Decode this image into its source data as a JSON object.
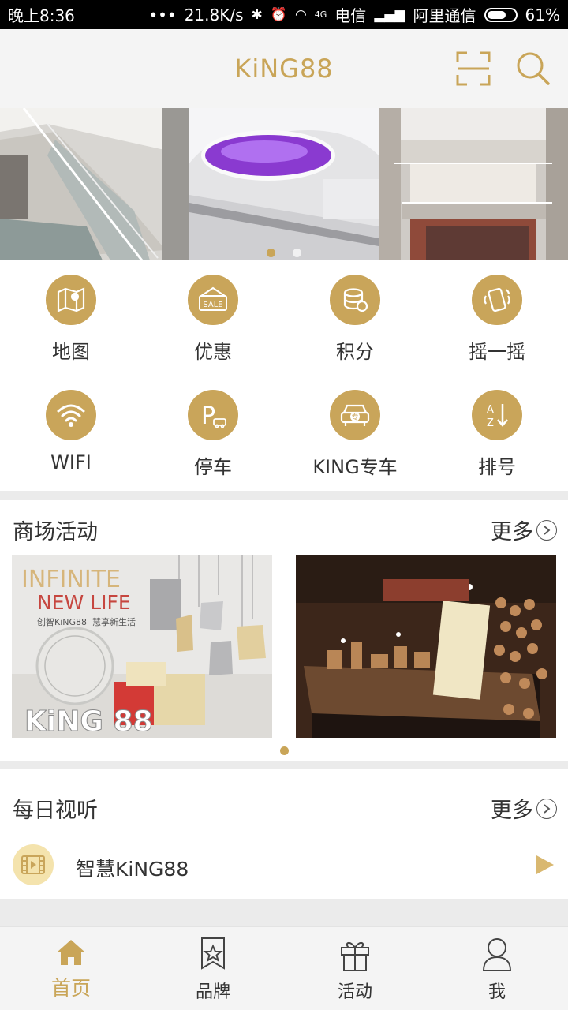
{
  "status_bar": {
    "time": "晚上8:36",
    "dots": "•••",
    "speed": "21.8K/s",
    "net_type": "4G",
    "carrier1": "电信",
    "carrier2": "阿里通信",
    "battery": "61%"
  },
  "header": {
    "title": "KiNG88",
    "scan_icon": "scan-icon",
    "search_icon": "search-icon"
  },
  "banner": {
    "slides": 3,
    "active_index": 0
  },
  "menu": {
    "items": [
      {
        "label": "地图",
        "icon": "map-icon"
      },
      {
        "label": "优惠",
        "icon": "sale-tag-icon",
        "icon_text": "SALE"
      },
      {
        "label": "积分",
        "icon": "coins-icon"
      },
      {
        "label": "摇一摇",
        "icon": "shake-phone-icon"
      },
      {
        "label": "WIFI",
        "icon": "wifi-icon"
      },
      {
        "label": "停车",
        "icon": "parking-icon",
        "icon_text": "P"
      },
      {
        "label": "KING专车",
        "icon": "car-icon",
        "icon_text": "专"
      },
      {
        "label": "排号",
        "icon": "queue-sort-icon",
        "icon_text_top": "A",
        "icon_text_bottom": "Z"
      }
    ]
  },
  "events": {
    "title": "商场活动",
    "more": "更多",
    "card1": {
      "line1": "INFINITE",
      "line2": "NEW LIFE",
      "line3": "创智KiNG88",
      "line4": "慧享新生活",
      "logo_text": "KiNG 88"
    },
    "card2": {
      "sign": "..."
    }
  },
  "daily": {
    "title": "每日视听",
    "more": "更多",
    "item_label": "智慧KiNG88"
  },
  "tabbar": {
    "tabs": [
      {
        "label": "首页",
        "icon": "home-icon",
        "active": true
      },
      {
        "label": "品牌",
        "icon": "brand-star-icon",
        "active": false
      },
      {
        "label": "活动",
        "icon": "gift-icon",
        "active": false
      },
      {
        "label": "我",
        "icon": "user-icon",
        "active": false
      }
    ]
  },
  "colors": {
    "accent": "#c9a558",
    "icon_bg": "#c9a55a"
  }
}
